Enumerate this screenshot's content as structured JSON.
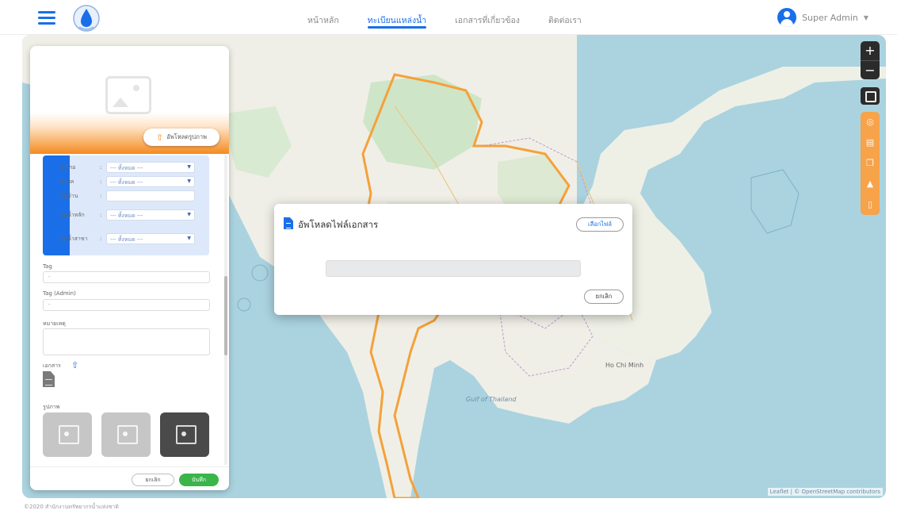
{
  "header": {
    "nav": [
      {
        "label": "หน้าหลัก",
        "active": false
      },
      {
        "label": "ทะเบียนแหล่งน้ำ",
        "active": true
      },
      {
        "label": "เอกสารที่เกี่ยวข้อง",
        "active": false
      },
      {
        "label": "ติดต่อเรา",
        "active": false
      }
    ],
    "user": {
      "name": "Super Admin",
      "caret": "▼"
    }
  },
  "map": {
    "zoom_in": "+",
    "zoom_out": "−",
    "attribution": "Leaflet | © OpenStreetMap contributors",
    "labels": [
      "Gulf of Thailand",
      "Ho Chi Minh"
    ],
    "tools": [
      "target-icon",
      "layers-icon",
      "copy-icon",
      "warning-icon",
      "document-icon"
    ]
  },
  "panel": {
    "upload_image_label": "อัพโหลดรูปภาพ",
    "location_fields": [
      {
        "label": "อำเภอ",
        "type": "select",
        "value": "--- ทั้งหมด ---"
      },
      {
        "label": "ตำบล",
        "type": "select",
        "value": "--- ทั้งหมด ---"
      },
      {
        "label": "หมู่บ้าน",
        "type": "input",
        "value": ""
      },
      {
        "label": "ลุ่มน้ำหลัก",
        "type": "select",
        "value": "--- ทั้งหมด ---"
      },
      {
        "label": "ลุ่มน้ำสาขา",
        "type": "select",
        "value": "--- ทั้งหมด ---"
      }
    ],
    "colon": ":",
    "tag_label": "Tag",
    "tag_value": "-",
    "tag_admin_label": "Tag (Admin)",
    "tag_admin_value": "-",
    "note_label": "หมายเหตุ",
    "documents_label": "เอกสาร",
    "images_label": "รูปภาพ",
    "cancel_label": "ยกเลิก",
    "save_label": "บันทึก"
  },
  "modal": {
    "title": "อัพโหลดไฟล์เอกสาร",
    "choose_file_label": "เลือกไฟล์",
    "progress": 0,
    "cancel_label": "ยกเลิก"
  },
  "footer": {
    "copyright": "©2020 สำนักงานทรัพยากรน้ำแห่งชาติ"
  },
  "colors": {
    "primary": "#1a6fe8",
    "accent": "#f58a1f",
    "success": "#3ab54a",
    "water": "#aad3df",
    "land": "#eef0e6"
  }
}
